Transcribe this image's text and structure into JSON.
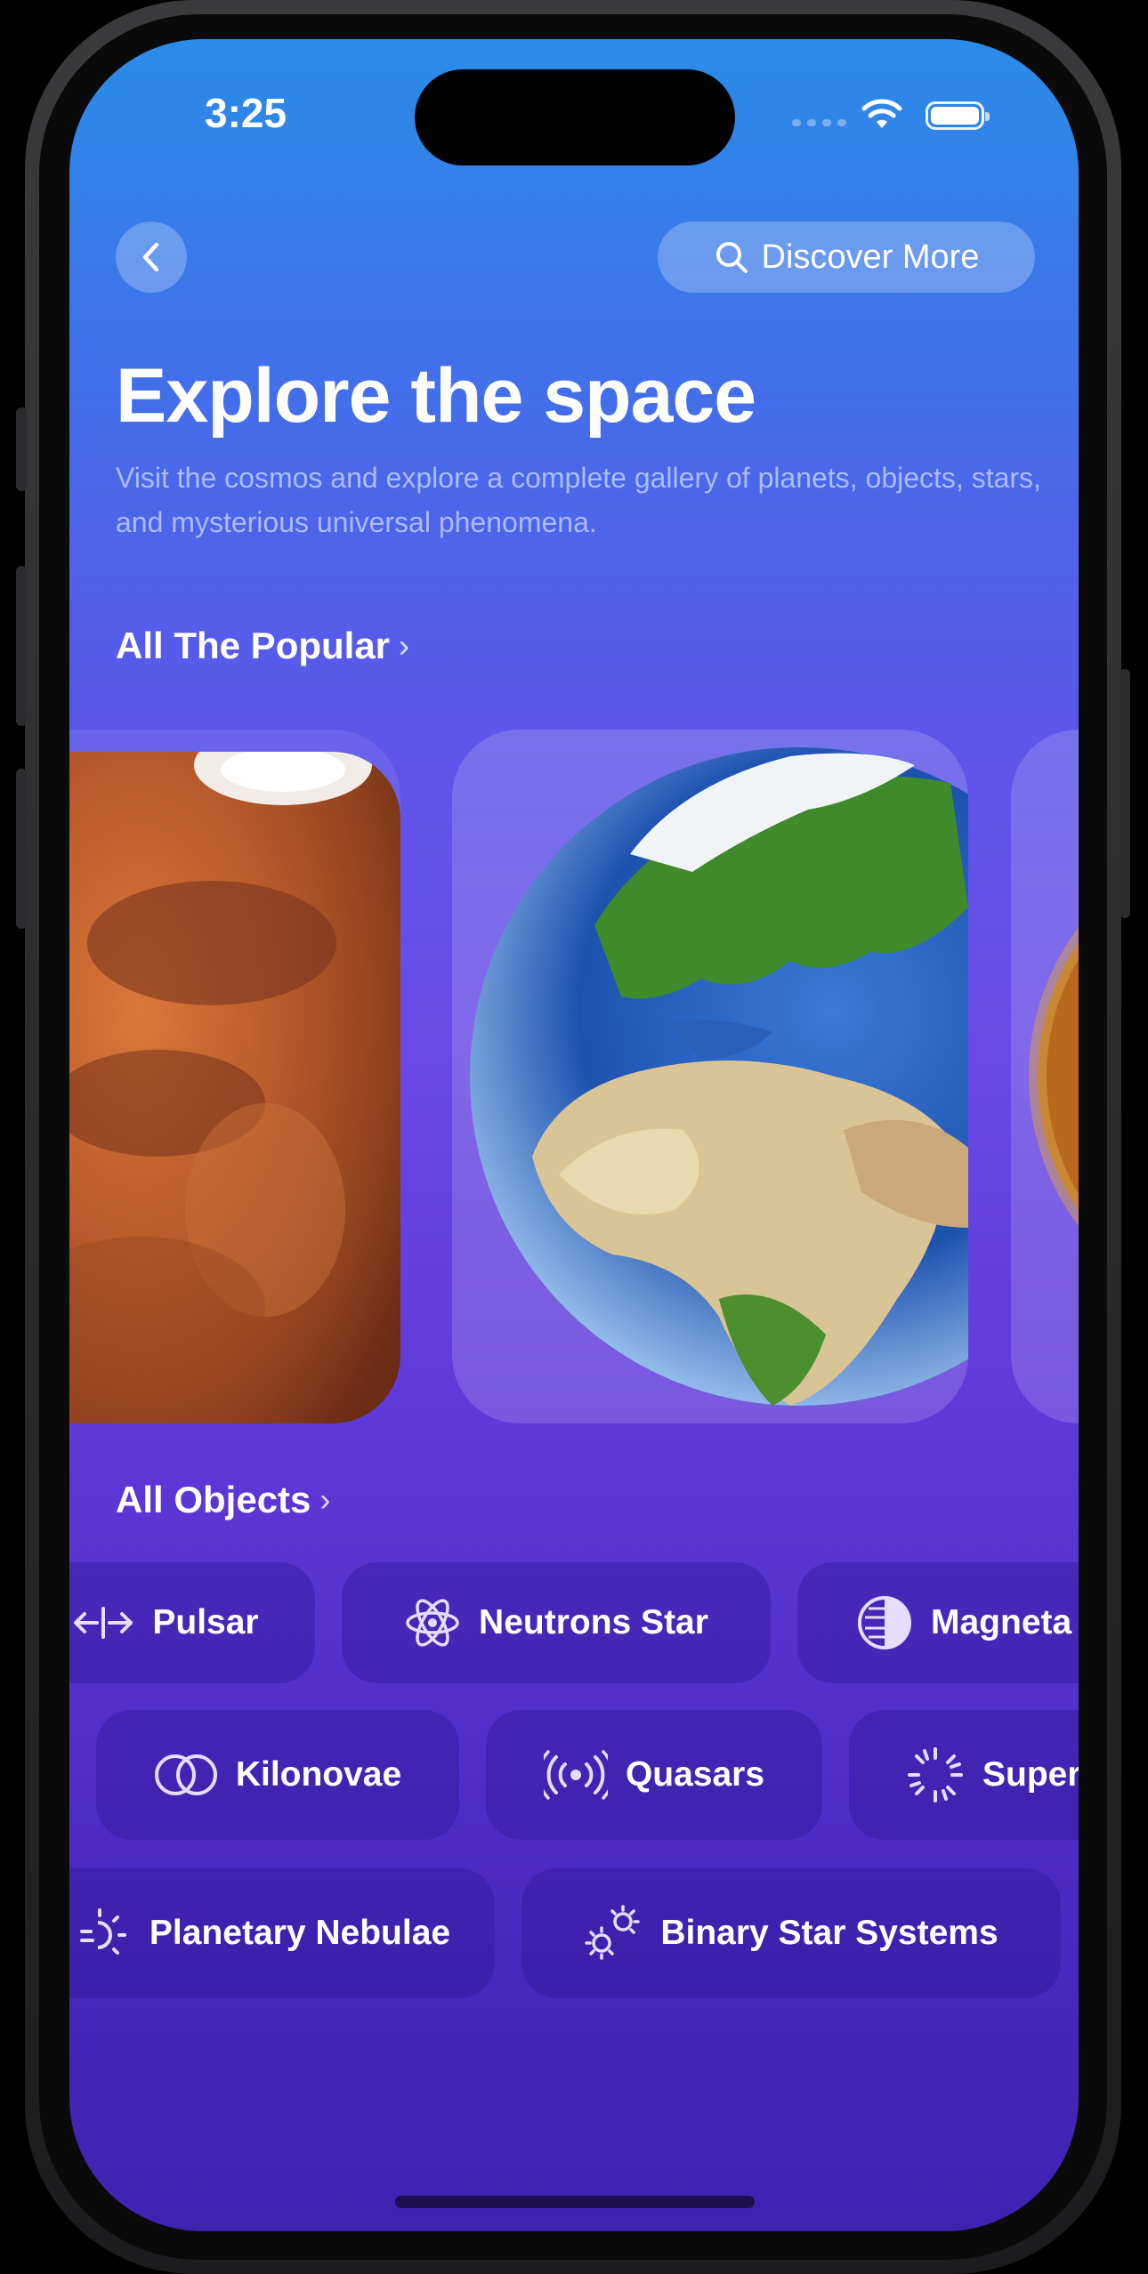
{
  "status_bar": {
    "time": "3:25"
  },
  "header": {
    "back_icon": "chevron-left-icon",
    "discover_label": "Discover More",
    "discover_icon": "search-icon"
  },
  "hero": {
    "title": "Explore the space",
    "subtitle": "Visit the cosmos and explore a complete gallery of planets, objects, stars, and mysterious universal phenomena."
  },
  "popular": {
    "heading": "All The Popular",
    "cards": [
      {
        "name": "mars",
        "icon": "mars-image"
      },
      {
        "name": "earth",
        "icon": "earth-image"
      },
      {
        "name": "venus",
        "icon": "planet-image"
      }
    ]
  },
  "objects": {
    "heading": "All Objects",
    "rows": [
      [
        {
          "label": "Pulsar",
          "icon": "arrows-left-right-icon"
        },
        {
          "label": "Neutrons Star",
          "icon": "atom-icon"
        },
        {
          "label": "Magneta",
          "icon": "half-circle-icon"
        }
      ],
      [
        {
          "label": "Kilonovae",
          "icon": "overlapping-circles-icon"
        },
        {
          "label": "Quasars",
          "icon": "broadcast-icon"
        },
        {
          "label": "Super",
          "icon": "rays-circle-icon"
        }
      ],
      [
        {
          "label": "Planetary Nebulae",
          "icon": "sun-haze-icon"
        },
        {
          "label": "Binary Star Systems",
          "icon": "two-suns-icon"
        }
      ]
    ]
  },
  "colors": {
    "gradient_top": "#2a8ce8",
    "gradient_bottom": "#3f22b0",
    "chip_bg": "#3a2aa0"
  }
}
